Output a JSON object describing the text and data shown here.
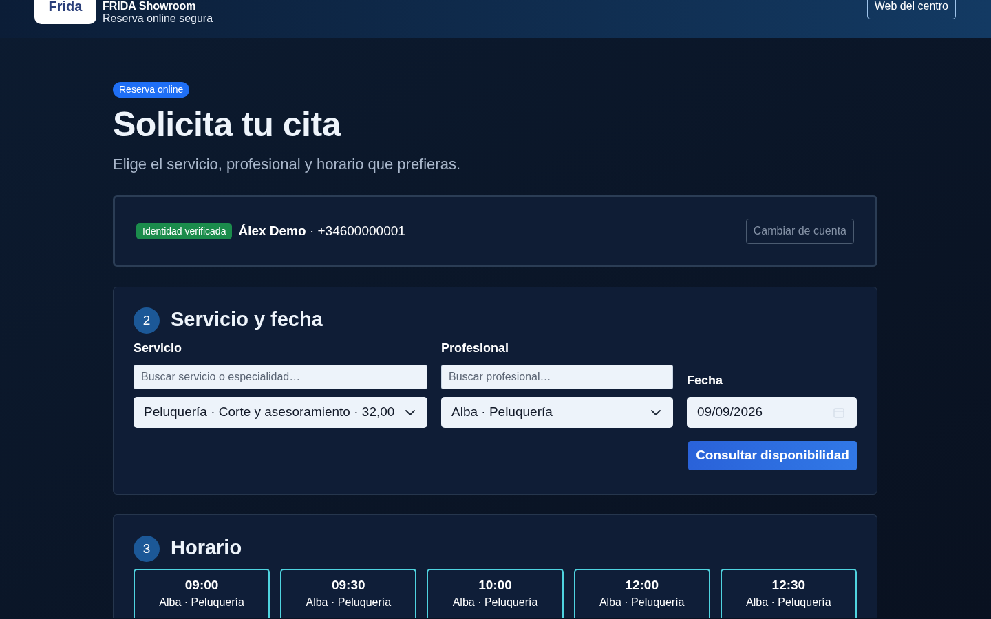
{
  "header": {
    "logo": "Frida",
    "title": "FRIDA Showroom",
    "subtitle": "Reserva online segura",
    "link": "Web del centro"
  },
  "intro": {
    "badge": "Reserva online",
    "title": "Solicita tu cita",
    "subtitle": "Elige el servicio, profesional y horario que prefieras."
  },
  "identity": {
    "badge": "Identidad verificada",
    "user": "**Álex Demo** · +34600000001",
    "button": "Cambiar de cuenta"
  },
  "service_section": {
    "step": "2",
    "title": "Servicio y fecha",
    "fields": [
      {
        "kind": "select",
        "label": "Servicio",
        "placeholder": "Buscar servicio o especialidad…",
        "value": "Peluquería · Corte y asesoramiento · 32,00"
      },
      {
        "kind": "select",
        "label": "Profesional",
        "placeholder": "Buscar profesional…",
        "value": "Alba · Peluquería"
      },
      {
        "kind": "date",
        "label": "Fecha",
        "value": "09/09/2026"
      }
    ],
    "button": "Consultar disponibilidad"
  },
  "schedule_section": {
    "step": "3",
    "title": "Horario",
    "slots": [
      {
        "time": "09:00",
        "detail": "Alba · Peluquería",
        "selected": false
      },
      {
        "time": "09:30",
        "detail": "Alba · Peluquería",
        "selected": false
      },
      {
        "time": "10:00",
        "detail": "Alba · Peluquería",
        "selected": false
      },
      {
        "time": "12:00",
        "detail": "Alba · Peluquería",
        "selected": false
      },
      {
        "time": "12:30",
        "detail": "Alba · Peluquería",
        "selected": false
      }
    ]
  }
}
